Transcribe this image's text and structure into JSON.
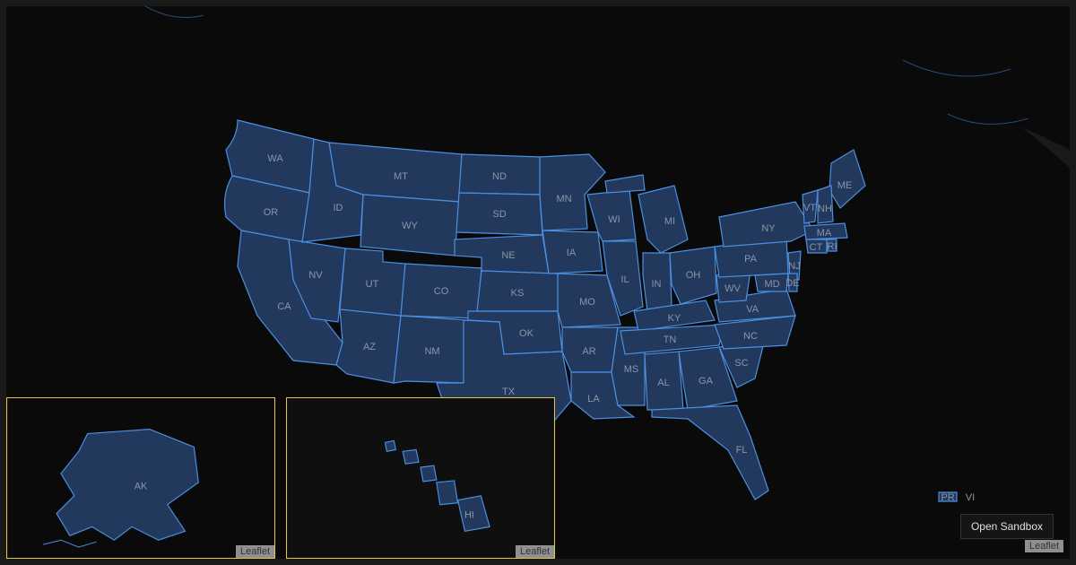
{
  "states": {
    "WA": "WA",
    "OR": "OR",
    "CA": "CA",
    "NV": "NV",
    "ID": "ID",
    "MT": "MT",
    "WY": "WY",
    "UT": "UT",
    "AZ": "AZ",
    "CO": "CO",
    "NM": "NM",
    "ND": "ND",
    "SD": "SD",
    "NE": "NE",
    "KS": "KS",
    "OK": "OK",
    "TX": "TX",
    "MN": "MN",
    "IA": "IA",
    "MO": "MO",
    "AR": "AR",
    "LA": "LA",
    "WI": "WI",
    "IL": "IL",
    "MS": "MS",
    "MI": "MI",
    "IN": "IN",
    "OH": "OH",
    "KY": "KY",
    "TN": "TN",
    "AL": "AL",
    "GA": "GA",
    "FL": "FL",
    "SC": "SC",
    "NC": "NC",
    "VA": "VA",
    "WV": "WV",
    "PA": "PA",
    "NY": "NY",
    "ME": "ME",
    "VT": "VT",
    "NH": "NH",
    "MA": "MA",
    "CT": "CT",
    "RI": "RI",
    "NJ": "NJ",
    "MD": "MD",
    "DE": "DE",
    "AK": "AK",
    "HI": "HI",
    "PR": "PR",
    "VI": "VI"
  },
  "buttons": {
    "open_sandbox": "Open Sandbox"
  },
  "attribution": {
    "leaflet": "Leaflet"
  },
  "colors": {
    "state_fill": "#22385c",
    "state_stroke": "#4a90e2",
    "inset_border": "#e6c34c",
    "label": "#8a96a8"
  }
}
